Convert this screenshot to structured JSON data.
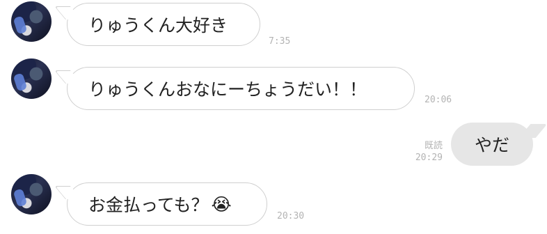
{
  "messages": [
    {
      "text": "りゅうくん大好き",
      "time": "7:35"
    },
    {
      "text": "りゅうくんおなにーちょうだい！！",
      "time": "20:06"
    },
    {
      "text": "やだ",
      "read": "既読",
      "time": "20:29"
    },
    {
      "text": "お金払っても？",
      "emoji": "😭",
      "time": "20:30"
    }
  ],
  "colors": {
    "incoming_bg": "#ffffff",
    "incoming_border": "#cfcfcf",
    "outgoing_bg": "#e6e6e6",
    "timestamp": "#b3b3b3"
  },
  "icons": {
    "sender_avatar": "avatar-photo"
  }
}
